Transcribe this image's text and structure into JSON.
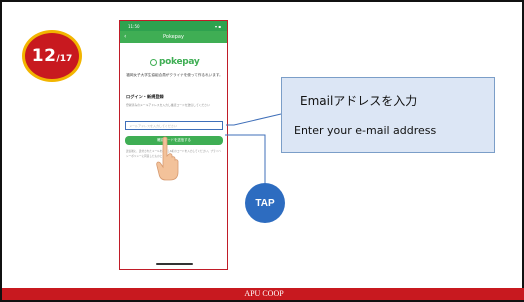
{
  "page_badge": {
    "current": "12",
    "total": "/17"
  },
  "phone": {
    "status_time": "11:50",
    "status_signal": "▾ ▪",
    "app_title": "Pokepay",
    "back_glyph": "‹",
    "logo_text": "pokepay",
    "description": "福岡女子大学生協組合員がクライナを使って作るれいます。",
    "section_label": "ログイン・新規登録",
    "hint_text": "登録済みのメールアドレスを入力し確認コードを送信してください",
    "email_placeholder": "メールアドレスを入力してください",
    "submit_label": "確認コードを送信する",
    "note_text": "送信後に、送付されたメールを確認し6桁のコードを入力してください。プライバシーポリシーに同意したものとします。"
  },
  "callout": {
    "jp_text": "Emailアドレスを入力",
    "en_text": "Enter your e-mail address"
  },
  "tap_label": "TAP",
  "footer_text": "APU COOP",
  "colors": {
    "brand_red": "#c8191f",
    "badge_ring": "#f2b500",
    "app_green": "#3fae54",
    "callout_fill": "#dce6f5",
    "tap_blue": "#2d6cc0"
  }
}
